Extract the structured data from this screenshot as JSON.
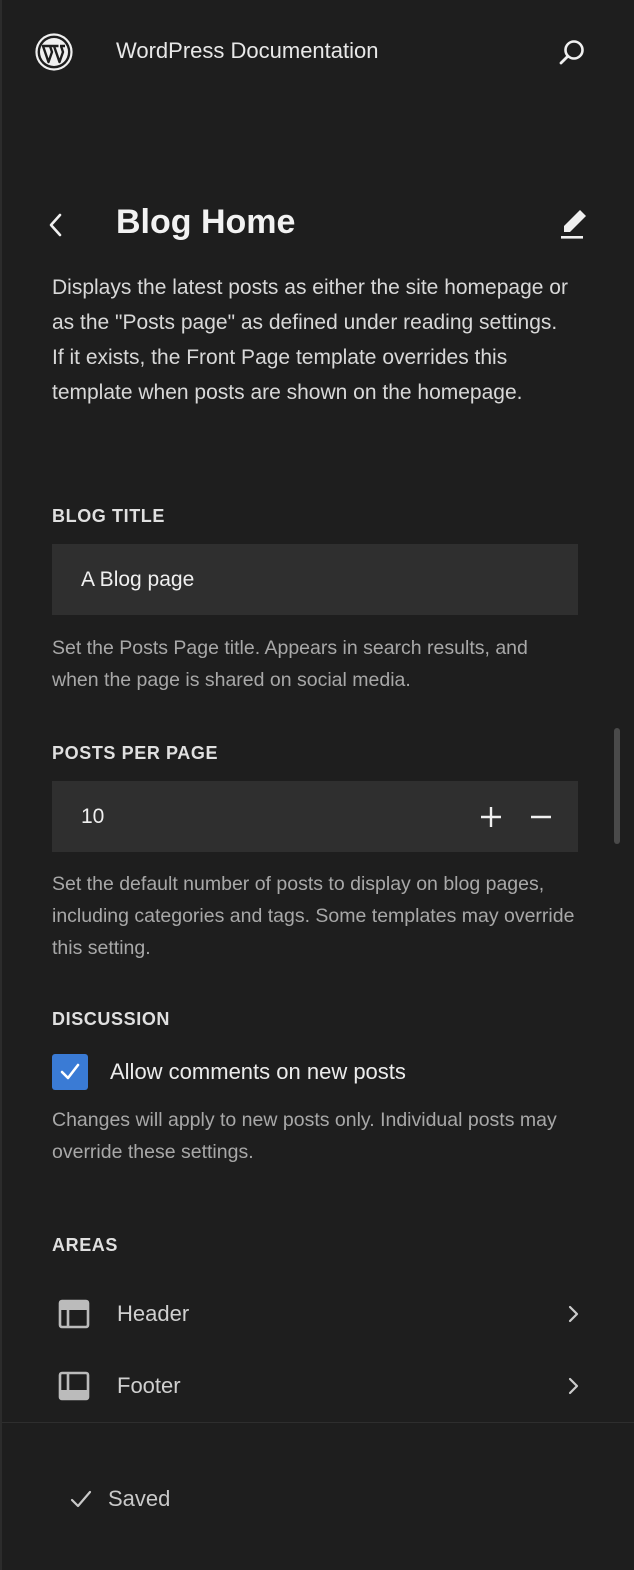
{
  "header": {
    "site_title": "WordPress Documentation",
    "logo_icon": "wordpress-logo-icon",
    "search_icon": "search-icon"
  },
  "template": {
    "title": "Blog Home",
    "description": "Displays the latest posts as either the site homepage or as the \"Posts page\" as defined under reading settings. If it exists, the Front Page template overrides this template when posts are shown on the homepage."
  },
  "blog_title": {
    "label": "BLOG TITLE",
    "value": "A Blog page",
    "help": "Set the Posts Page title. Appears in search results, and when the page is shared on social media."
  },
  "posts_per_page": {
    "label": "POSTS PER PAGE",
    "value": "10",
    "help": "Set the default number of posts to display on blog pages, including categories and tags. Some templates may override this setting."
  },
  "discussion": {
    "label": "DISCUSSION",
    "checkbox_label": "Allow comments on new posts",
    "checked": true,
    "help": "Changes will apply to new posts only. Individual posts may override these settings."
  },
  "areas": {
    "label": "AREAS",
    "items": [
      {
        "label": "Header",
        "icon": "header-layout-icon"
      },
      {
        "label": "Footer",
        "icon": "footer-layout-icon"
      }
    ]
  },
  "status": {
    "saved_label": "Saved"
  },
  "colors": {
    "background": "#1e1e1e",
    "field": "#2f2f2f",
    "accent": "#3a7bd5"
  }
}
